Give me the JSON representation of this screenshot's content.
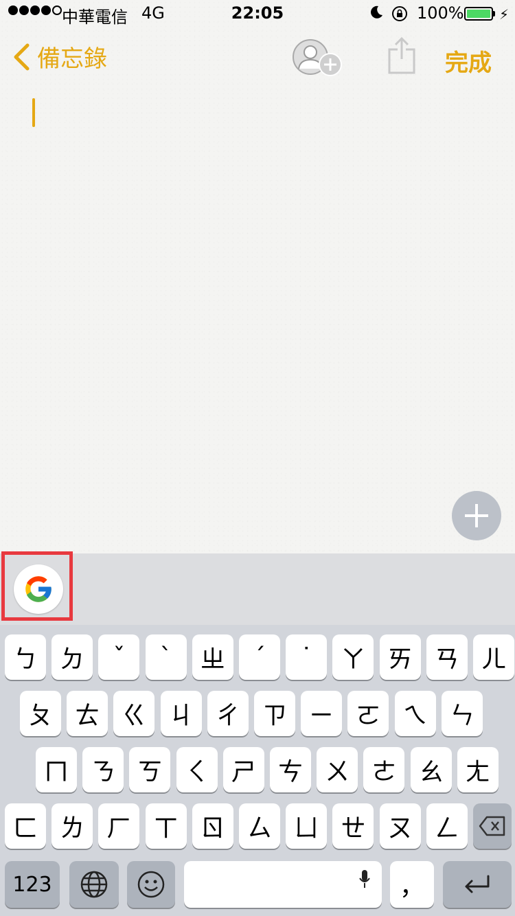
{
  "status_bar": {
    "carrier": "中華電信",
    "network": "4G",
    "time": "22:05",
    "battery": "100%"
  },
  "nav": {
    "back_label": "備忘錄",
    "done_label": "完成"
  },
  "keyboard": {
    "row1": [
      "ㄅ",
      "ㄉ",
      "ˇ",
      "ˋ",
      "ㄓ",
      "ˊ",
      "˙",
      "ㄚ",
      "ㄞ",
      "ㄢ",
      "ㄦ"
    ],
    "row2": [
      "ㄆ",
      "ㄊ",
      "ㄍ",
      "ㄐ",
      "ㄔ",
      "ㄗ",
      "ㄧ",
      "ㄛ",
      "ㄟ",
      "ㄣ"
    ],
    "row3": [
      "ㄇ",
      "ㄋ",
      "ㄎ",
      "ㄑ",
      "ㄕ",
      "ㄘ",
      "ㄨ",
      "ㄜ",
      "ㄠ",
      "ㄤ"
    ],
    "row4": [
      "ㄈ",
      "ㄌ",
      "ㄏ",
      "ㄒ",
      "ㄖ",
      "ㄙ",
      "ㄩ",
      "ㄝ",
      "ㄡ",
      "ㄥ"
    ],
    "numbers_label": "123",
    "comma_label": "，"
  },
  "colors": {
    "accent": "#e5a814",
    "highlight": "#e8393f"
  }
}
